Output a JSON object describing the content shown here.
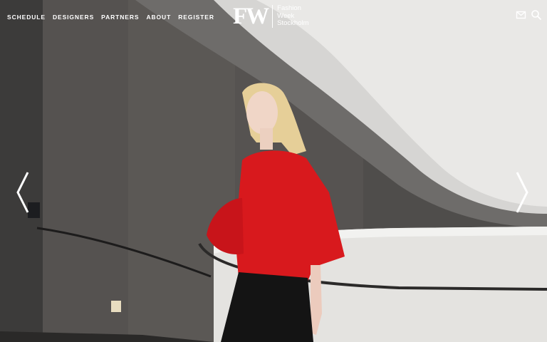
{
  "nav": {
    "items": [
      {
        "label": "SCHEDULE"
      },
      {
        "label": "DESIGNERS"
      },
      {
        "label": "PARTNERS"
      },
      {
        "label": "ABOUT"
      },
      {
        "label": "REGISTER"
      }
    ]
  },
  "logo": {
    "mark": "FW",
    "lines": [
      "Fashion",
      "Week",
      "Stockholm"
    ]
  },
  "header_icons": {
    "mail": "mail-icon",
    "search": "search-icon"
  },
  "slider": {
    "prev_icon": "chevron-left-icon",
    "next_icon": "chevron-right-icon"
  },
  "colors": {
    "nav_text": "#ffffff",
    "garment_red": "#d8191d"
  }
}
